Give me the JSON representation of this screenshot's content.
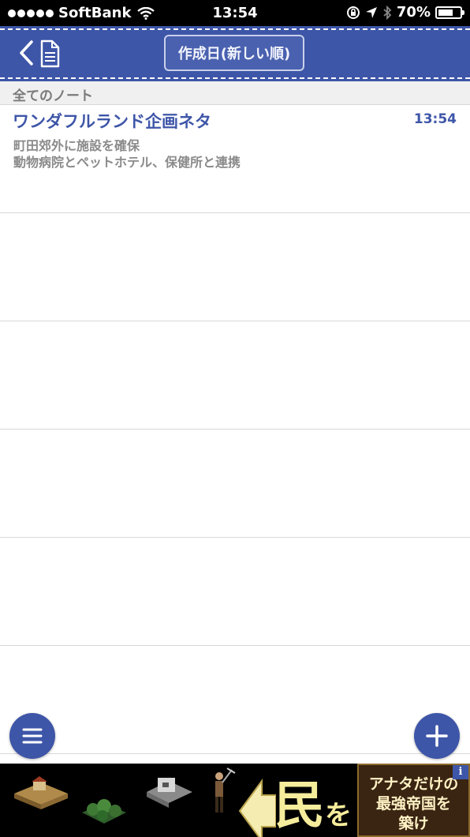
{
  "status_bar": {
    "carrier": "SoftBank",
    "time": "13:54",
    "battery": "70%",
    "battery_level": 0.7
  },
  "nav": {
    "sort_label": "作成日(新しい順)",
    "colors": {
      "bar": "#3e56a8",
      "accent_text": "#3e56a8"
    }
  },
  "section": {
    "title": "全てのノート"
  },
  "notes": [
    {
      "title": "ワンダフルランド企画ネタ",
      "time": "13:54",
      "lines": [
        "町田郊外に施設を確保",
        "動物病院とペットホテル、保健所と連携"
      ]
    }
  ],
  "icons": {
    "back": "chevron-left-icon",
    "notes": "document-icon",
    "menu": "hamburger-icon",
    "add": "plus-icon"
  },
  "ad": {
    "headline_kanji": "民",
    "headline_kana": "を",
    "copy_lines": [
      "アナタだけの",
      "最強帝国を",
      "築け"
    ],
    "info": "i"
  }
}
